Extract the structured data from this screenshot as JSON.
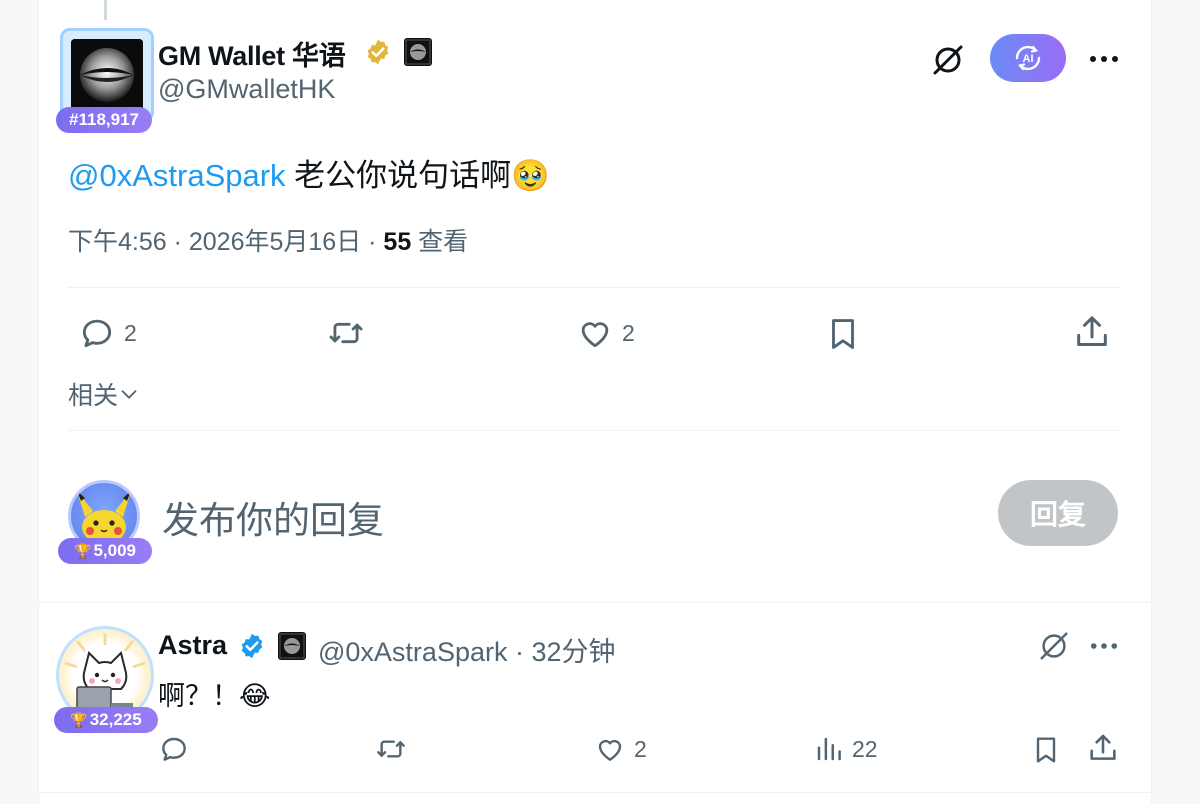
{
  "tweet": {
    "author": {
      "name": "GM Wallet 华语",
      "handle": "@GMwalletHK",
      "rank": "#118,917"
    },
    "mention": "@0xAstraSpark",
    "text": " 老公你说句话啊",
    "emoji": "🥹",
    "time": "下午4:56 · 2026年5月16日 · ",
    "views_count": "55",
    "views_label": " 查看",
    "stats": {
      "replies": "2",
      "likes": "2"
    }
  },
  "related_label": "相关",
  "composer": {
    "placeholder": "发布你的回复",
    "reply_button": "回复",
    "user_rank": "5,009"
  },
  "reply": {
    "name": "Astra",
    "handle_time": "@0xAstraSpark · 32分钟",
    "text": "啊？！",
    "emoji": "😂",
    "rank": "32,225",
    "stats": {
      "likes": "2",
      "views": "22"
    }
  },
  "colors": {
    "accent": "#1d9bf0",
    "secondary_text": "#536471",
    "badge": "#8a74f3",
    "gold_verified": "#e2b53b",
    "blue_verified": "#1d9bf0"
  },
  "icons": [
    "grok-slash-icon",
    "ai-icon",
    "more-icon",
    "reply-icon",
    "retweet-icon",
    "like-icon",
    "bookmark-icon",
    "share-icon",
    "views-icon",
    "chevron-down-icon"
  ]
}
